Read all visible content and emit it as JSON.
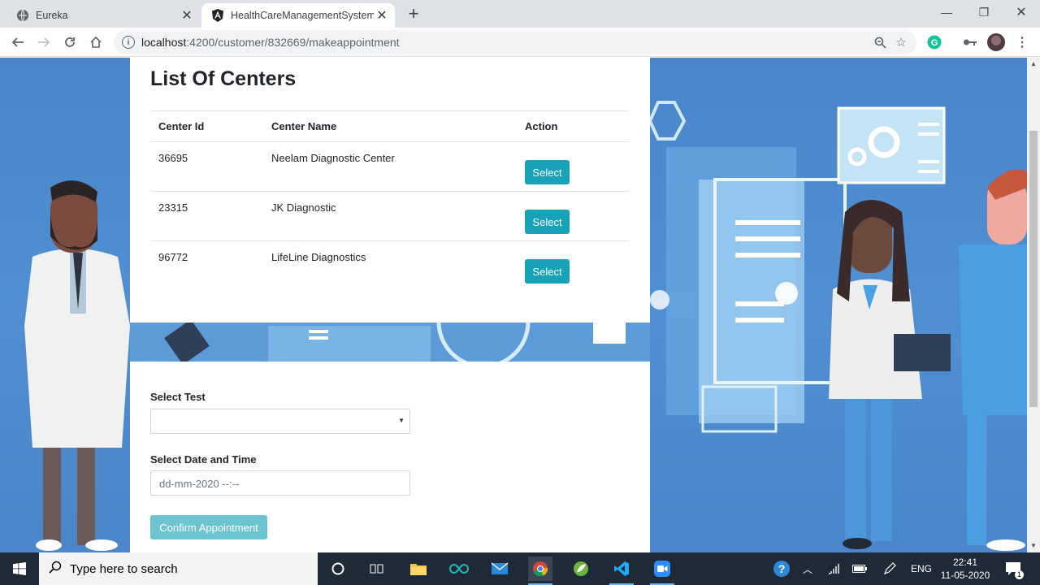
{
  "browser": {
    "tabs": [
      {
        "title": "Eureka",
        "active": false
      },
      {
        "title": "HealthCareManagementSystem",
        "active": true
      }
    ],
    "url_host": "localhost",
    "url_path": ":4200/customer/832669/makeappointment"
  },
  "page": {
    "centers_title": "List Of Centers",
    "table": {
      "headers": [
        "Center Id",
        "Center Name",
        "Action"
      ],
      "rows": [
        {
          "id": "36695",
          "name": "Neelam Diagnostic Center",
          "action": "Select"
        },
        {
          "id": "23315",
          "name": "JK Diagnostic",
          "action": "Select"
        },
        {
          "id": "96772",
          "name": "LifeLine Diagnostics",
          "action": "Select"
        }
      ]
    },
    "select_test_label": "Select Test",
    "select_test_value": "",
    "datetime_label": "Select Date and Time",
    "datetime_placeholder": "dd-mm-2020 --:--",
    "confirm_label": "Confirm Appointment"
  },
  "taskbar": {
    "search_placeholder": "Type here to search",
    "language": "ENG",
    "time": "22:41",
    "date": "11-05-2020",
    "notifications": "1"
  },
  "colors": {
    "accent": "#17a2b8",
    "accent_disabled": "#6cc4d1",
    "page_bg": "#4a85ca"
  }
}
